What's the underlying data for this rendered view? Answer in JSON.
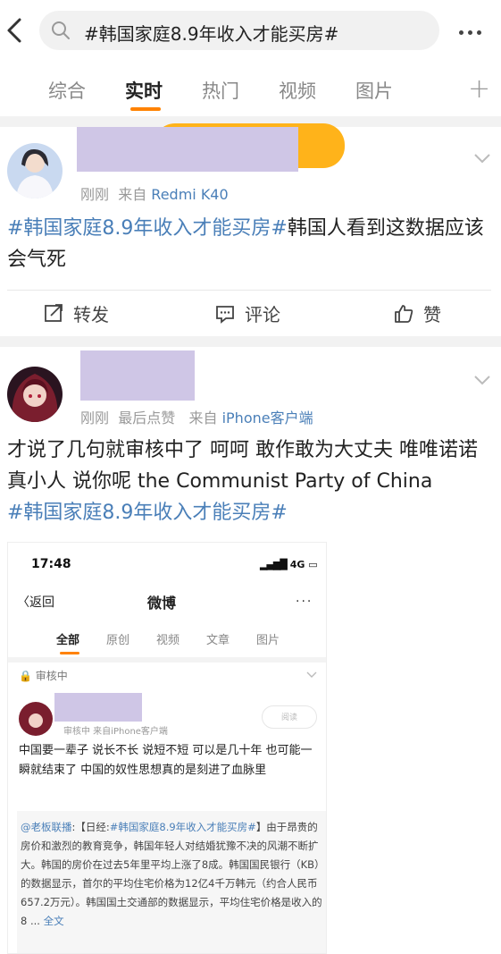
{
  "search": {
    "query": "#韩国家庭8.9年收入才能买房#"
  },
  "tabs": [
    {
      "label": "综合"
    },
    {
      "label": "实时"
    },
    {
      "label": "热门"
    },
    {
      "label": "视频"
    },
    {
      "label": "图片"
    }
  ],
  "colors": {
    "accent": "#ff8200",
    "link": "#4a7fb8",
    "redaction": "#cfc6e6"
  },
  "post1": {
    "time": "刚刚",
    "source_prefix": "来自",
    "source": "Redmi K40",
    "hashtag": "#韩国家庭8.9年收入才能买房#",
    "body": "韩国人看到这数据应该会气死",
    "actions": {
      "repost": "转发",
      "comment": "评论",
      "like": "赞"
    }
  },
  "post2": {
    "time": "刚刚",
    "liked_note": "最后点赞",
    "source_prefix": "来自",
    "source": "iPhone客户端",
    "body": "才说了几句就审核中了 呵呵 敢作敢为大丈夫 唯唯诺诺真小人 说你呢 the Communist Party of China",
    "hashtag": "#韩国家庭8.9年收入才能买房#"
  },
  "embed": {
    "status_time": "17:48",
    "status_signal": "4G",
    "back": "〈返回",
    "title": "微博",
    "tabs": [
      "全部",
      "原创",
      "视频",
      "文章",
      "图片"
    ],
    "review_label": "审核中",
    "meta": "审核中 来自iPhone客户端",
    "read_label": "阅读",
    "text": "中国要一辈子 说长不长 说短不短 可以是几十年 也可能一瞬就结束了 中国的奴性思想真的是刻进了血脉里",
    "quote_user": "@老板联播",
    "quote_prefix": ":【日经:",
    "quote_tag": "#韩国家庭8.9年收入才能买房#",
    "quote_body": "】由于昂贵的房价和激烈的教育竞争，韩国年轻人对结婚犹豫不决的风潮不断扩大。韩国的房价在过去5年里平均上涨了8成。韩国国民银行（KB）的数据显示，首尔的平均住宅价格为12亿4千万韩元（约合人民币657.2万元）。韩国国土交通部的数据显示，平均住宅价格是收入的8 ...",
    "quote_more": "全文"
  }
}
